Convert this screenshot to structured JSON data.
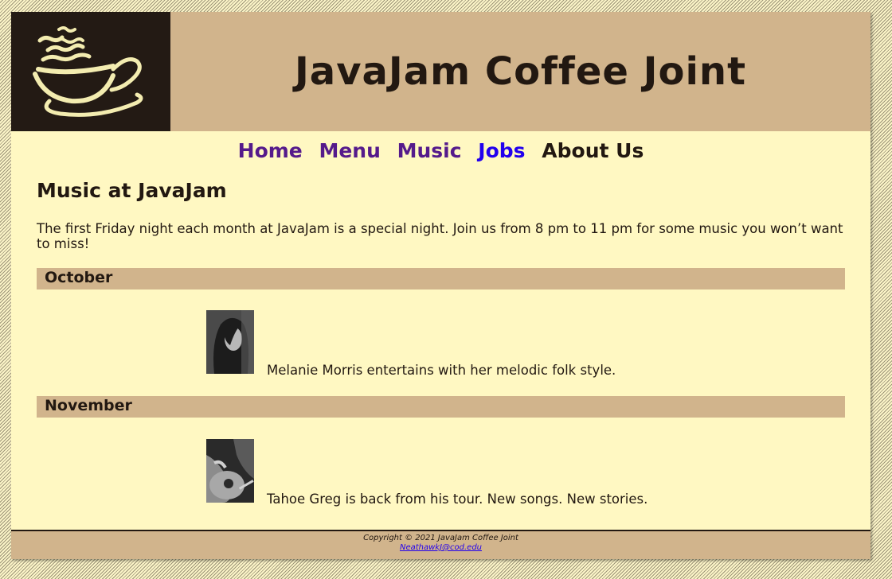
{
  "site": {
    "title": "JavaJam Coffee Joint"
  },
  "nav": {
    "items": [
      {
        "label": "Home"
      },
      {
        "label": "Menu"
      },
      {
        "label": "Music"
      },
      {
        "label": "Jobs"
      },
      {
        "label": "About Us"
      }
    ]
  },
  "main": {
    "heading": "Music at JavaJam",
    "intro": "The first Friday night each month at JavaJam is a special night. Join us from 8 pm to 11 pm for some music you won’t want to miss!",
    "events": [
      {
        "month": "October",
        "description": "Melanie Morris entertains with her melodic folk style."
      },
      {
        "month": "November",
        "description": "Tahoe Greg is back from his tour. New songs. New stories."
      }
    ]
  },
  "footer": {
    "copyright": "Copyright © 2021 JavaJam Coffee Joint",
    "email": "NeathawkJ@cod.edu"
  },
  "colors": {
    "header_bg": "#d1b48c",
    "page_bg": "#fff8c2",
    "logo_bg": "#231a14",
    "text": "#221811",
    "visited_link": "#551a8b",
    "link": "#2200ee"
  },
  "icons": {
    "logo": "coffee-cup-icon"
  }
}
